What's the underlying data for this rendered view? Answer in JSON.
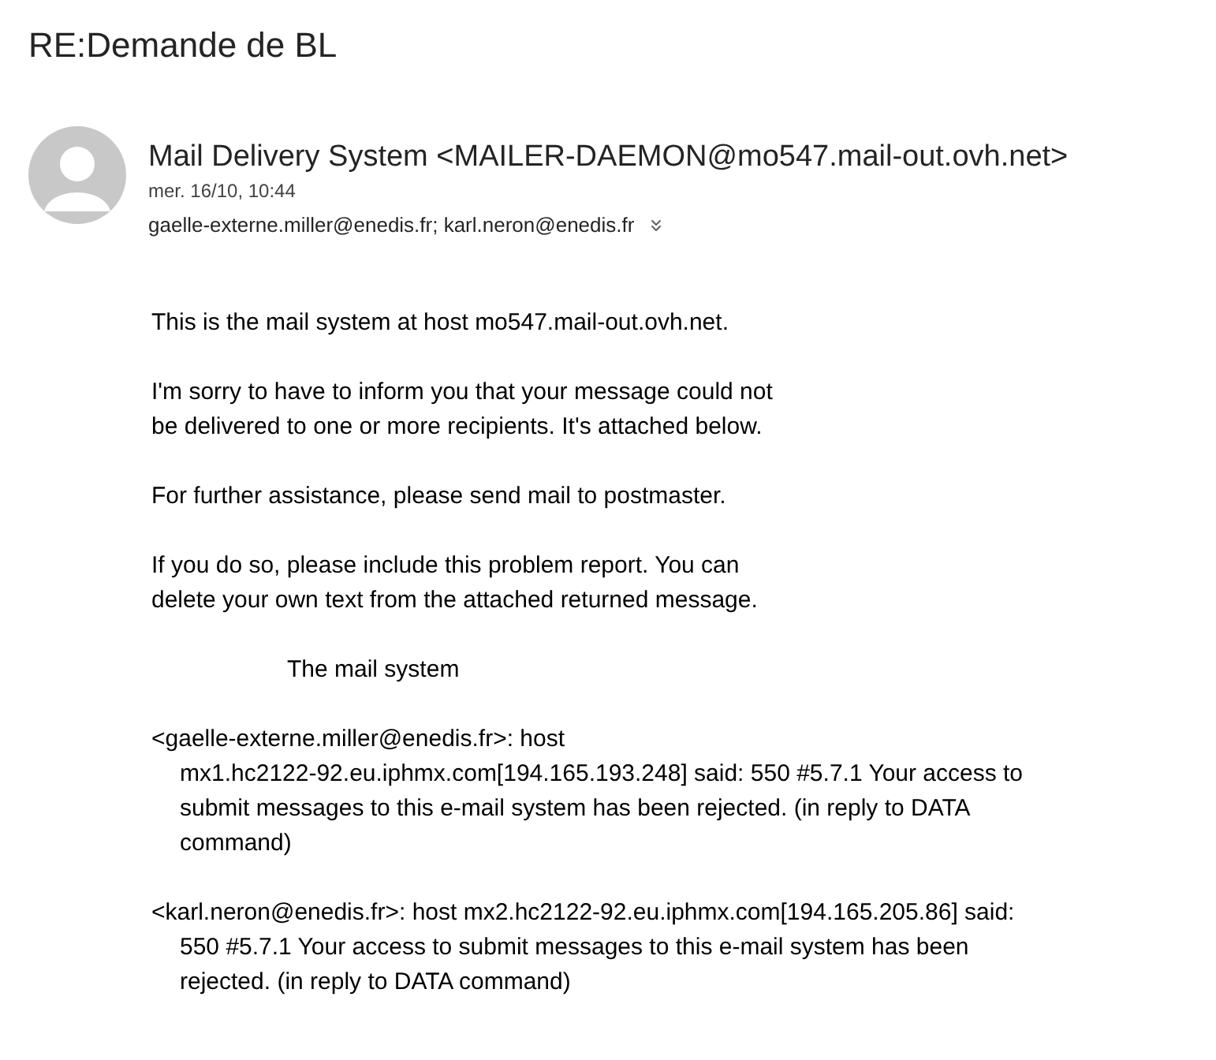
{
  "subject": "RE:Demande de BL",
  "sender": {
    "name": "Mail Delivery System <MAILER-DAEMON@mo547.mail-out.ovh.net>",
    "date": "mer. 16/10, 10:44",
    "recipients": "gaelle-externe.miller@enedis.fr; karl.neron@enedis.fr"
  },
  "body": [
    {
      "kind": "plain",
      "lines": [
        "This is the mail system at host mo547.mail-out.ovh.net."
      ]
    },
    {
      "kind": "plain",
      "lines": [
        "I'm sorry to have to inform you that your message could not",
        "be delivered to one or more recipients. It's attached below."
      ]
    },
    {
      "kind": "plain",
      "lines": [
        "For further assistance, please send mail to postmaster."
      ]
    },
    {
      "kind": "plain",
      "lines": [
        "If you do so, please include this problem report. You can",
        "delete your own text from the attached returned message."
      ]
    },
    {
      "kind": "signature",
      "lines": [
        "The mail system"
      ]
    },
    {
      "kind": "bounce",
      "lines": [
        "<gaelle-externe.miller@enedis.fr>: host",
        "mx1.hc2122-92.eu.iphmx.com[194.165.193.248] said: 550 #5.7.1 Your access to",
        "submit messages to this e-mail system has been rejected. (in reply to DATA",
        "command)"
      ]
    },
    {
      "kind": "bounce",
      "lines": [
        "<karl.neron@enedis.fr>: host mx2.hc2122-92.eu.iphmx.com[194.165.205.86] said:",
        "550 #5.7.1 Your access to submit messages to this e-mail system has been",
        "rejected. (in reply to DATA command)"
      ]
    }
  ]
}
